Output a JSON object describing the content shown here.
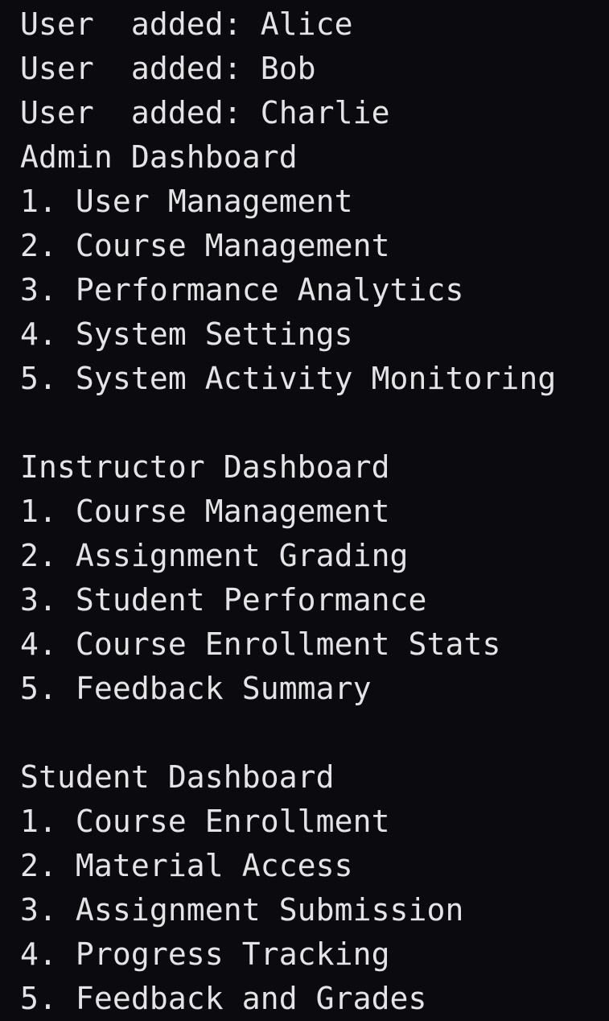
{
  "terminal": {
    "lines": [
      "User  added: Alice",
      "User  added: Bob",
      "User  added: Charlie",
      "Admin Dashboard",
      "1. User Management",
      "2. Course Management",
      "3. Performance Analytics",
      "4. System Settings",
      "5. System Activity Monitoring",
      "",
      "Instructor Dashboard",
      "1. Course Management",
      "2. Assignment Grading",
      "3. Student Performance",
      "4. Course Enrollment Stats",
      "5. Feedback Summary",
      "",
      "Student Dashboard",
      "1. Course Enrollment",
      "2. Material Access",
      "3. Assignment Submission",
      "4. Progress Tracking",
      "5. Feedback and Grades"
    ],
    "colors": {
      "background": "#0b0b0f",
      "text": "#e4e4e6"
    }
  }
}
